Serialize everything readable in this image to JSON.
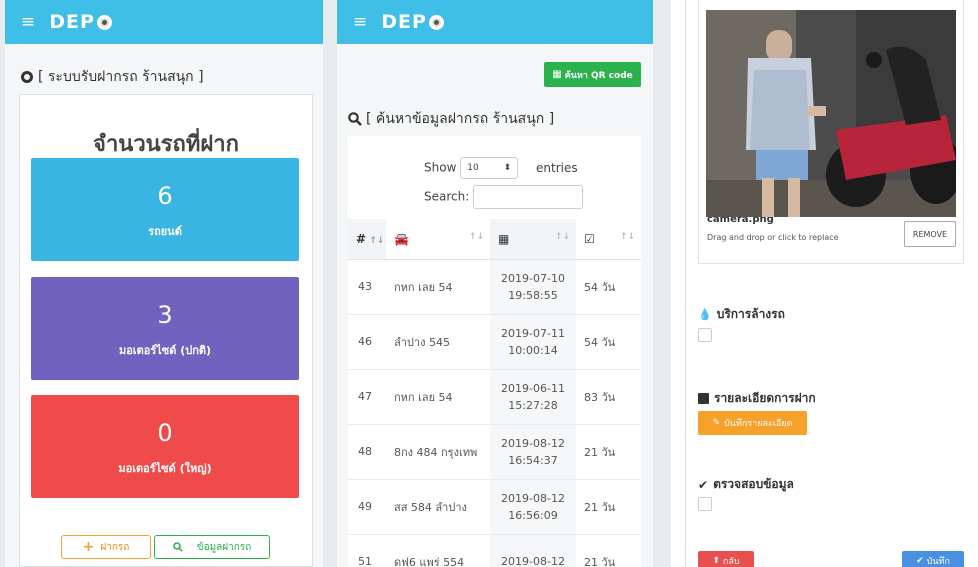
{
  "app": {
    "logo": "DEP",
    "menu_icon": "hamburger-icon"
  },
  "screen1": {
    "section_title": "[ ระบบรับฝากรถ ร้านสนุก ]",
    "counter_title": "จำนวนรถที่ฝาก",
    "stats": [
      {
        "count": "6",
        "label": "รถยนต์",
        "color": "#3ab4e3"
      },
      {
        "count": "3",
        "label": "มอเตอร์ไซด์ (ปกติ)",
        "color": "#7062be"
      },
      {
        "count": "0",
        "label": "มอเตอร์ไซด์ (ใหญ่)",
        "color": "#f04b4b"
      }
    ],
    "deposit_button": "ฝากรถ",
    "info_button": "ข้อมูลฝากรถ"
  },
  "screen2": {
    "qr_button": "ค้นหา QR code",
    "search_title": "[ ค้นหาข้อมูลฝากรถ ร้านสนุก ]",
    "show_label": "Show",
    "page_size": "10",
    "entries_label": "entries",
    "search_label": "Search:",
    "header_no": "#",
    "rows": [
      {
        "id": "43",
        "plate": "กหก เลย 54",
        "date": "2019-07-10",
        "time": "19:58:55",
        "days": "54 วัน"
      },
      {
        "id": "46",
        "plate": "ลำปาง 545",
        "date": "2019-07-11",
        "time": "10:00:14",
        "days": "54 วัน"
      },
      {
        "id": "47",
        "plate": "กหก เลย 54",
        "date": "2019-06-11",
        "time": "15:27:28",
        "days": "83 วัน"
      },
      {
        "id": "48",
        "plate": "8กง 484 กรุงเทพ",
        "date": "2019-08-12",
        "time": "16:54:37",
        "days": "21 วัน"
      },
      {
        "id": "49",
        "plate": "สส 584 ลำปาง",
        "date": "2019-08-12",
        "time": "16:56:09",
        "days": "21 วัน"
      },
      {
        "id": "51",
        "plate": "ดฟ6 แพร่ 554",
        "date": "2019-08-12",
        "time": "",
        "days": "21 วัน"
      }
    ]
  },
  "screen3": {
    "file_name": "camera.png",
    "file_hint": "Drag and drop or click to replace",
    "remove_button": "REMOVE",
    "wash_label": "บริการล้างรถ",
    "detail_label": "รายละเอียดการฝาก",
    "detail_button": "บันทึกรายละเอียด",
    "verify_label": "ตรวจสอบข้อมูล",
    "back_button": "กลับ",
    "save_button": "บันทึก"
  },
  "colors": {
    "topbar": "#3fbfe8",
    "green": "#2bb24c",
    "orange": "#f5a12a",
    "red": "#e85050",
    "blue": "#4a90e2"
  }
}
